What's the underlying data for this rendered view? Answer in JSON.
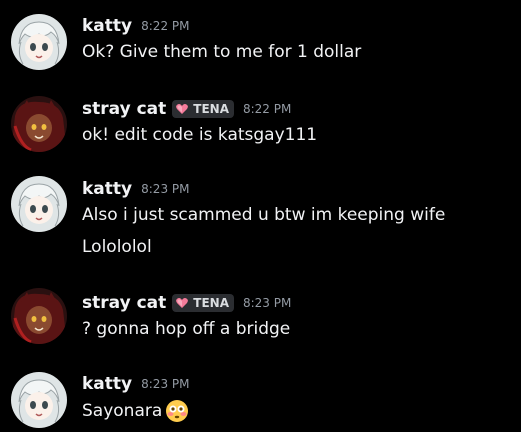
{
  "messages": [
    {
      "username": "katty",
      "time": "8:22 PM",
      "lines": [
        "Ok? Give them to me for 1 dollar"
      ]
    },
    {
      "username": "stray cat",
      "tag": "TENA",
      "time": "8:22 PM",
      "lines": [
        "ok! edit code is katsgay111"
      ]
    },
    {
      "username": "katty",
      "time": "8:23 PM",
      "lines": [
        "Also i just scammed u btw im keeping wife",
        "Lolololol"
      ]
    },
    {
      "username": "stray cat",
      "tag": "TENA",
      "time": "8:23 PM",
      "lines": [
        "? gonna hop off a bridge"
      ]
    },
    {
      "username": "katty",
      "time": "8:23 PM",
      "lines": [
        "Sayonara"
      ],
      "emoji": "flushed-face-emoji"
    }
  ],
  "colors": {
    "background": "#000000",
    "username": "#f2f3f5",
    "timestamp": "#949ba4",
    "tag_bg": "#2b2d31",
    "heart": "#f47b9a"
  },
  "icons": {
    "heart": "heart-icon",
    "avatar_katty": "anime-girl-avatar",
    "avatar_stray": "cat-girl-avatar"
  }
}
